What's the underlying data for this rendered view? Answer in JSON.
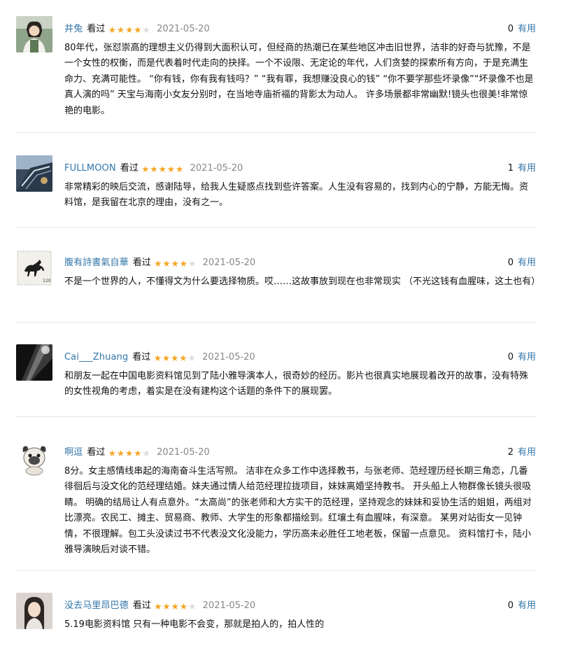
{
  "comments": [
    {
      "user": "井兔",
      "status": "看过",
      "rating": 4,
      "time": "2021-05-20",
      "votes": "0",
      "vote_label": "有用",
      "content": "80年代，张怼崇高的理想主义仍得到大面积认可，但经商的热潮已在某些地区冲击旧世界，洁非的好奇与犹豫，不是一个女性的权衡，而是代表着时代走向的抉择。一个不设限、无定论的年代，人们贪婪的探索所有方向，于是充满生命力、充满可能性。 “你有钱，你有我有钱吗？” “我有罪，我想赚没良心的钱” “你不要学那些坏录像”“坏录像不也是真人演的吗” 天宝与海南小女友分别时，在当地寺庙祈福的背影太为动人。 许多场景都非常幽默!镜头也很美!非常惊艳的电影。",
      "avatar_icon": "avatar-woman-outdoor"
    },
    {
      "user": "FULLMOON",
      "status": "看过",
      "rating": 5,
      "time": "2021-05-20",
      "votes": "1",
      "vote_label": "有用",
      "content": "非常精彩的映后交流，感谢陆导，给我人生疑惑点找到些许答案。人生没有容易的，找到内心的宁静，方能无悔。资料馆，是我留在北京的理由，没有之一。",
      "avatar_icon": "avatar-architecture"
    },
    {
      "user": "腹有詩書氣自華",
      "status": "看过",
      "rating": 4,
      "time": "2021-05-20",
      "votes": "0",
      "vote_label": "有用",
      "content": "不是一个世界的人，不懂得文为什么要选择物质。哎……这故事放到现在也非常现实 （不光这钱有血腥味，这土也有）",
      "avatar_icon": "avatar-horse-stamp"
    },
    {
      "user": "Cai___Zhuang",
      "status": "看过",
      "rating": 4,
      "time": "2021-05-20",
      "votes": "0",
      "vote_label": "有用",
      "content": "和朋友一起在中国电影资料馆见到了陆小雅导演本人，很奇妙的经历。影片也很真实地展现着改开的故事，没有特殊的女性视角的考虑，着实是在没有建构这个话题的条件下的展现罢。",
      "avatar_icon": "avatar-dark-light"
    },
    {
      "user": "啊逗",
      "status": "看过",
      "rating": 4,
      "time": "2021-05-20",
      "votes": "2",
      "vote_label": "有用",
      "content": "8分。女主感情线串起的海南奋斗生活写照。 洁非在众多工作中选择教书，与张老师、范经理历经长期三角恋，几番徘徊后与没文化的范经理结婚。妹夫通过情人给范经理拉拢项目，妹妹离婚坚持教书。 开头船上人物群像长镜头很吸睛。 明确的结局让人有点意外。“太高尚”的张老师和大方实干的范经理，坚持观念的妹妹和妥协生活的姐姐，两组对比漂亮。农民工、摊主、贸易商、教师、大学生的形象都描绘到。红壤土有血腥味，有深意。 某男对站街女一见钟情，不很理解。包工头没读过书不代表没文化没能力，学历高未必胜任工地老板，保留一点意见。 资料馆打卡，陆小雅导演映后对谈不错。",
      "avatar_icon": "avatar-pug-cartoon"
    },
    {
      "user": "没去马里昂巴德",
      "status": "看过",
      "rating": 4,
      "time": "2021-05-20",
      "votes": "0",
      "vote_label": "有用",
      "content": "5.19电影资料馆 只有一种电影不会变，那就是拍人的，拍人性的",
      "avatar_icon": "avatar-woman-portrait"
    }
  ]
}
